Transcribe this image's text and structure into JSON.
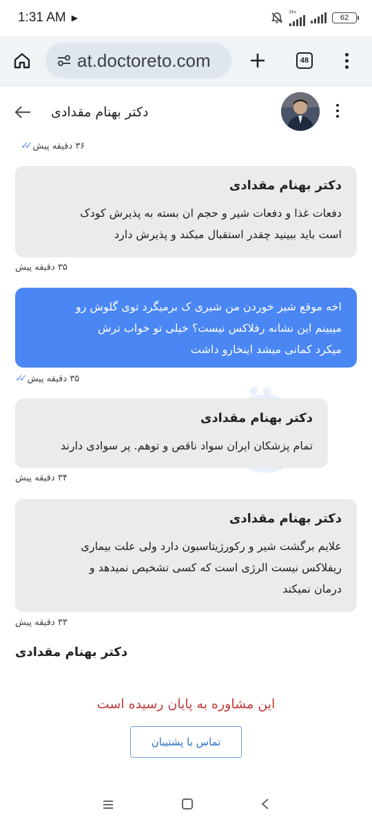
{
  "status_bar": {
    "time": "1:31 AM",
    "network_label": "H+",
    "battery": "62"
  },
  "browser": {
    "url": "at.doctoreto.com",
    "tab_count": "48"
  },
  "chat_header": {
    "title": "دکتر بهنام مقدادی"
  },
  "messages": [
    {
      "direction": "out",
      "time": "۳۶ دقیقه پیش"
    },
    {
      "direction": "in",
      "sender": "دکتر بهنام مقدادی",
      "lines": [
        "دفعات غذا و دفعات شیر و حجم ان بسته به پذیرش کودک",
        "است باید ببینید چقدر استقبال مبکند و پذیرش دارد"
      ],
      "time": "۳۵ دقیقه پیش"
    },
    {
      "direction": "out",
      "lines": [
        "اخه موقع شیر خوردن من شیری ک برمیگرد توی گلوش رو",
        "میبینم این نشانه رفلاکس نیست؟ خیلی تو خواب ترش",
        "میکرد کمانی میشد اینخارو داشت"
      ],
      "time": "۳۵ دقیقه پیش"
    },
    {
      "direction": "in",
      "sender": "دکتر بهنام مقدادی",
      "lines": [
        "تمام پزشکان ایران سواد ناقص و توهم. پر سوادی دارند"
      ],
      "time": "۳۴ دقیقه پیش"
    },
    {
      "direction": "in",
      "sender": "دکتر بهنام مقدادی",
      "lines": [
        "علایم برگشت شیر و رکورژیتاسبون دارد ولی علت بیماری",
        "ریفلاکس نیست الرژی است که کسی تشخیص نمیدهد و",
        "درمان نمیکند"
      ],
      "time": "۳۳ دقیقه پیش"
    }
  ],
  "footer": {
    "doctor_name": "دکتر بهنام مقدادی",
    "ended_message": "این مشاوره به پایان رسیده است",
    "support_button": "تماس با پشتیبان"
  },
  "colors": {
    "outgoing_bubble": "#4a86f4",
    "incoming_bubble": "#ebebeb",
    "ended_text": "#c23a3a",
    "support_button_border": "#6a9be0"
  },
  "icons": [
    "home-icon",
    "site-settings-icon",
    "new-tab-icon",
    "tab-switcher-icon",
    "overflow-menu-icon",
    "back-arrow-icon",
    "double-check-icon",
    "recents-icon",
    "home-nav-icon",
    "back-nav-icon",
    "mute-icon"
  ]
}
